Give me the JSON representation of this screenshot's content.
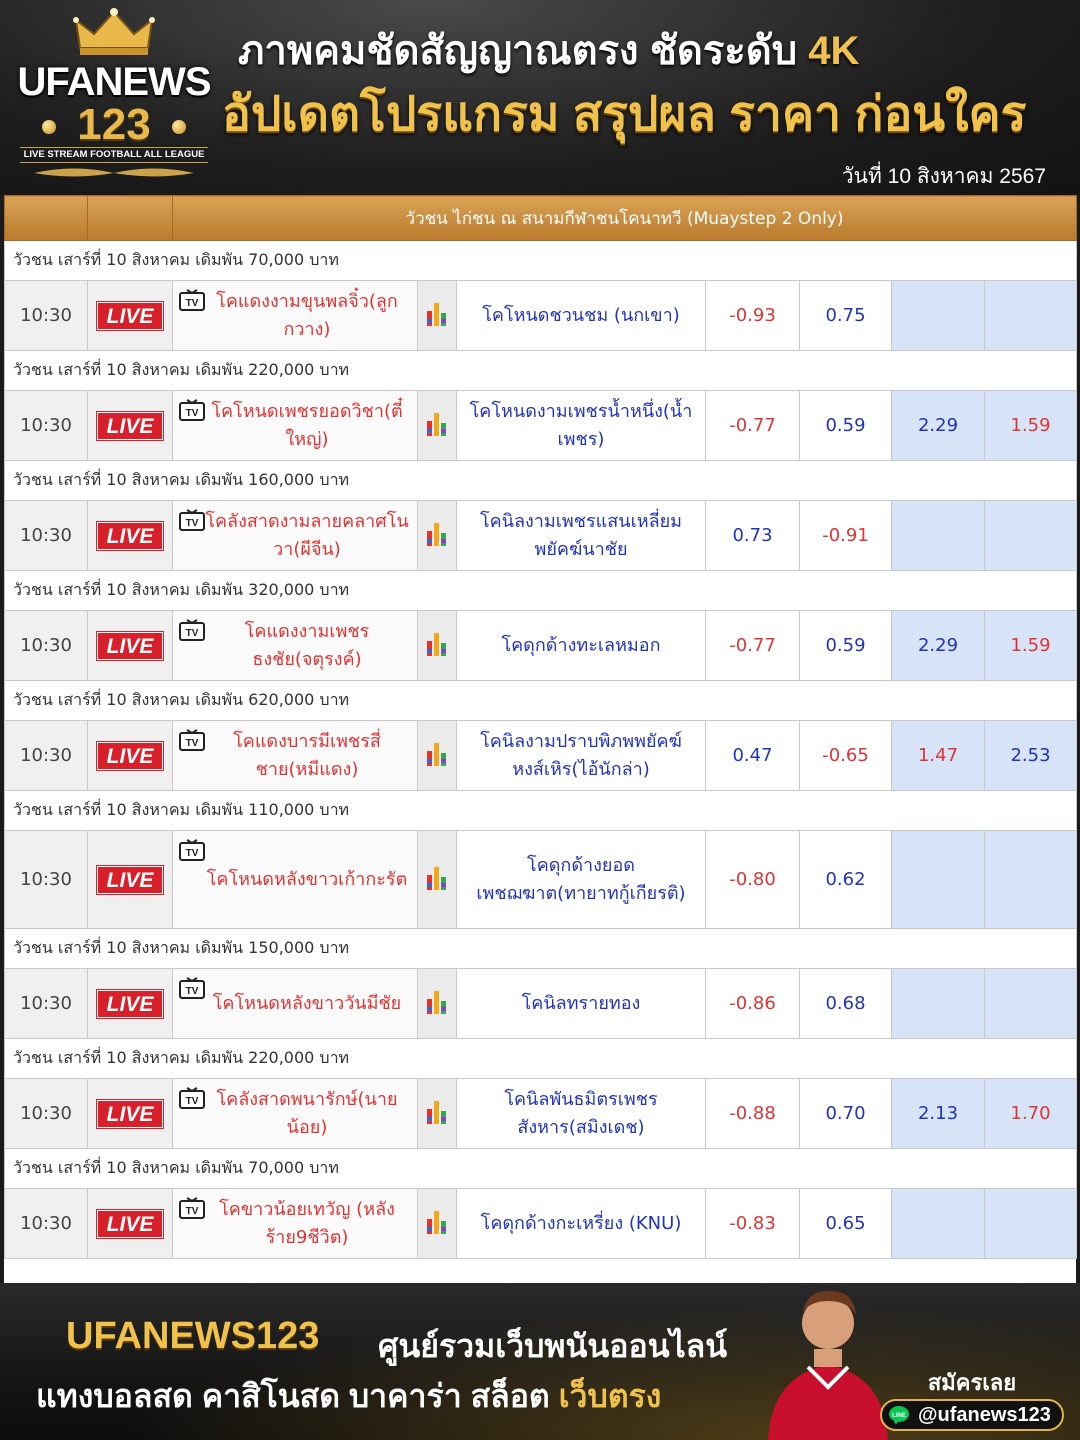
{
  "header": {
    "logo_text": "UFANEWS",
    "logo_number": "123",
    "logo_tagline": "LIVE STREAM FOOTBALL ALL LEAGUE",
    "headline1_text": "ภาพคมชัดสัญญาณตรง ชัดระดับ ",
    "headline1_highlight": "4K",
    "headline2": "อัปเดตโปรแกรม สรุปผล ราคา ก่อนใคร",
    "date": "วันที่ 10 สิงหาคม 2567"
  },
  "table": {
    "title": "วัวชน ไก่ชน ณ สนามกีฬาชนโคนาทวี (Muaystep 2 Only)",
    "live_label": "LIVE",
    "groups": [
      {
        "round": "วัวชน เสาร์ที่ 10 สิงหาคม เดิมพัน 70,000 บาท",
        "time": "10:30",
        "home": "โคแดงงามขุนพลจิ๋ว(ลูกกวาง)",
        "away": "โคโหนดชวนชม (นกเขา)",
        "odd1": "-0.93",
        "odd2": "0.75",
        "odd3": "",
        "odd4": ""
      },
      {
        "round": "วัวชน เสาร์ที่ 10 สิงหาคม เดิมพัน 220,000 บาท",
        "time": "10:30",
        "home": "โคโหนดเพชรยอดวิชา(ตี๋ใหญ่)",
        "away": "โคโหนดงามเพชรน้ำหนึ่ง(น้ำเพชร)",
        "odd1": "-0.77",
        "odd2": "0.59",
        "odd3": "2.29",
        "odd4": "1.59"
      },
      {
        "round": "วัวชน เสาร์ที่ 10 สิงหาคม เดิมพัน 160,000 บาท",
        "time": "10:30",
        "home": "โคลังสาดงามลายคลาศโนวา(ผีจีน)",
        "away": "โคนิลงามเพชรแสนเหลี่ยมพยัคฆ์นาชัย",
        "odd1": "0.73",
        "odd2": "-0.91",
        "odd3": "",
        "odd4": ""
      },
      {
        "round": "วัวชน เสาร์ที่ 10 สิงหาคม เดิมพัน 320,000 บาท",
        "time": "10:30",
        "home": "โคแดงงามเพชรธงชัย(จตุรงค์)",
        "away": "โคดุกด้างทะเลหมอก",
        "odd1": "-0.77",
        "odd2": "0.59",
        "odd3": "2.29",
        "odd4": "1.59"
      },
      {
        "round": "วัวชน เสาร์ที่ 10 สิงหาคม เดิมพัน 620,000 บาท",
        "time": "10:30",
        "home": "โคแดงบารมีเพชรสี่ชาย(หมีแดง)",
        "away": "โคนิลงามปราบพิภพพยัคฆ์หงส์เหิร(ไอ้นักล่า)",
        "odd1": "0.47",
        "odd2": "-0.65",
        "odd3": "1.47",
        "odd4": "2.53"
      },
      {
        "round": "วัวชน เสาร์ที่ 10 สิงหาคม เดิมพัน 110,000 บาท",
        "time": "10:30",
        "home": "โคโหนดหลังขาวเก้ากะรัต",
        "away": "โคดุกด้างยอดเพชฌฆาต(ทายาทกู้เกียรติ)",
        "odd1": "-0.80",
        "odd2": "0.62",
        "odd3": "",
        "odd4": ""
      },
      {
        "round": "วัวชน เสาร์ที่ 10 สิงหาคม เดิมพัน 150,000 บาท",
        "time": "10:30",
        "home": "โคโหนดหลังขาววันมีชัย",
        "away": "โคนิลทรายทอง",
        "odd1": "-0.86",
        "odd2": "0.68",
        "odd3": "",
        "odd4": ""
      },
      {
        "round": "วัวชน เสาร์ที่ 10 สิงหาคม เดิมพัน 220,000 บาท",
        "time": "10:30",
        "home": "โคลังสาดพนารักษ์(นายน้อย)",
        "away": "โคนิลพันธมิตรเพชรสังหาร(สมิงเดช)",
        "odd1": "-0.88",
        "odd2": "0.70",
        "odd3": "2.13",
        "odd4": "1.70"
      },
      {
        "round": "วัวชน เสาร์ที่ 10 สิงหาคม เดิมพัน 70,000 บาท",
        "time": "10:30",
        "home": "โคขาวน้อยเทวัญ (หลังร้าย9ชีวิต)",
        "away": "โคดุกด้างกะเหรี่ยง (KNU)",
        "odd1": "-0.83",
        "odd2": "0.65",
        "odd3": "",
        "odd4": ""
      }
    ]
  },
  "footer": {
    "brand": "UFANEWS123",
    "tagline": "ศูนย์รวมเว็บพนันออนไลน์",
    "line2_text": "แทงบอลสด คาสิโนสด บาคาร่า สล็อต ",
    "line2_highlight": "เว็บตรง",
    "signup": "สมัครเลย",
    "line_id": "@ufanews123"
  },
  "colors": {
    "header_gold": "#f0c24c",
    "table_head": "#c98a3a",
    "live_red": "#d8202a",
    "home_red": "#e03333",
    "away_blue": "#2233bb",
    "extra_cell": "#d7e3f6"
  },
  "icons": [
    "crown-icon",
    "tv-icon",
    "stats-bars-icon",
    "line-app-icon"
  ]
}
